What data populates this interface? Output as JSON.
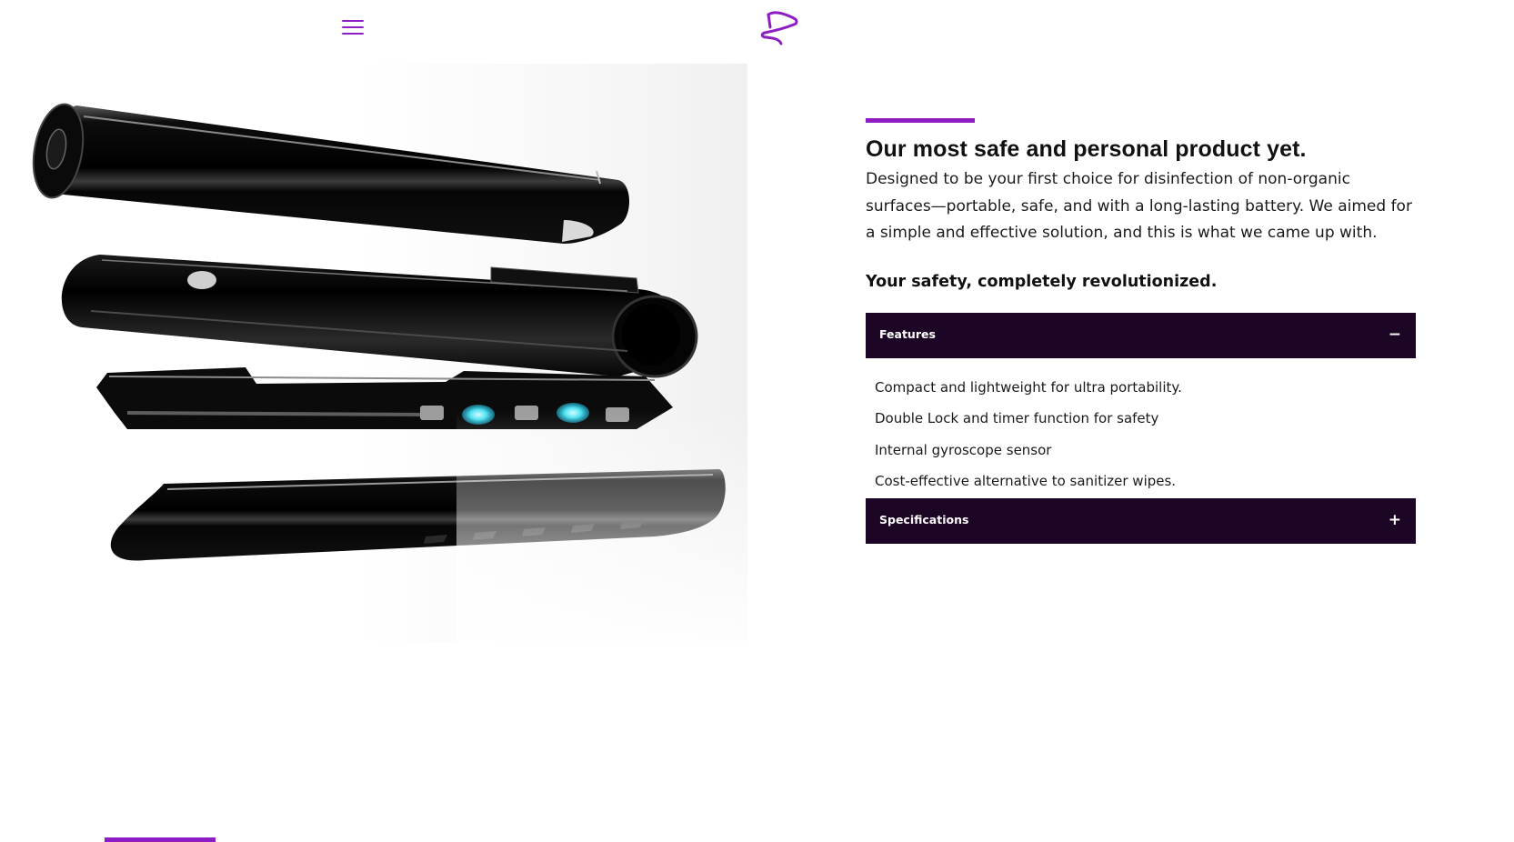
{
  "colors": {
    "accent": "#8e1ec3",
    "accordion_bg": "#1d0625",
    "text": "#111111",
    "background": "#ffffff",
    "uv_led": "#4fe3f2"
  },
  "header": {
    "menu_icon": "hamburger-menu-icon",
    "logo_icon": "brand-logo-icon"
  },
  "product_image": {
    "subject": "exploded view of UV disinfection wand components"
  },
  "content": {
    "headline": "Our most safe and personal product yet.",
    "description": "Designed to be your first choice for disinfection of non-organic surfaces—portable, safe, and with a long-lasting battery. We aimed for a simple and effective solution, and this is what we came up with.",
    "tagline": "Your safety, completely revolutionized."
  },
  "accordion": {
    "features": {
      "label": "Features",
      "toggle": "−",
      "expanded": true,
      "items": [
        "Compact and lightweight for ultra portability.",
        "Double Lock and timer function for safety",
        "Internal gyroscope sensor",
        "Cost-effective alternative to sanitizer wipes."
      ]
    },
    "specifications": {
      "label": "Specifications",
      "toggle": "+",
      "expanded": false
    }
  }
}
